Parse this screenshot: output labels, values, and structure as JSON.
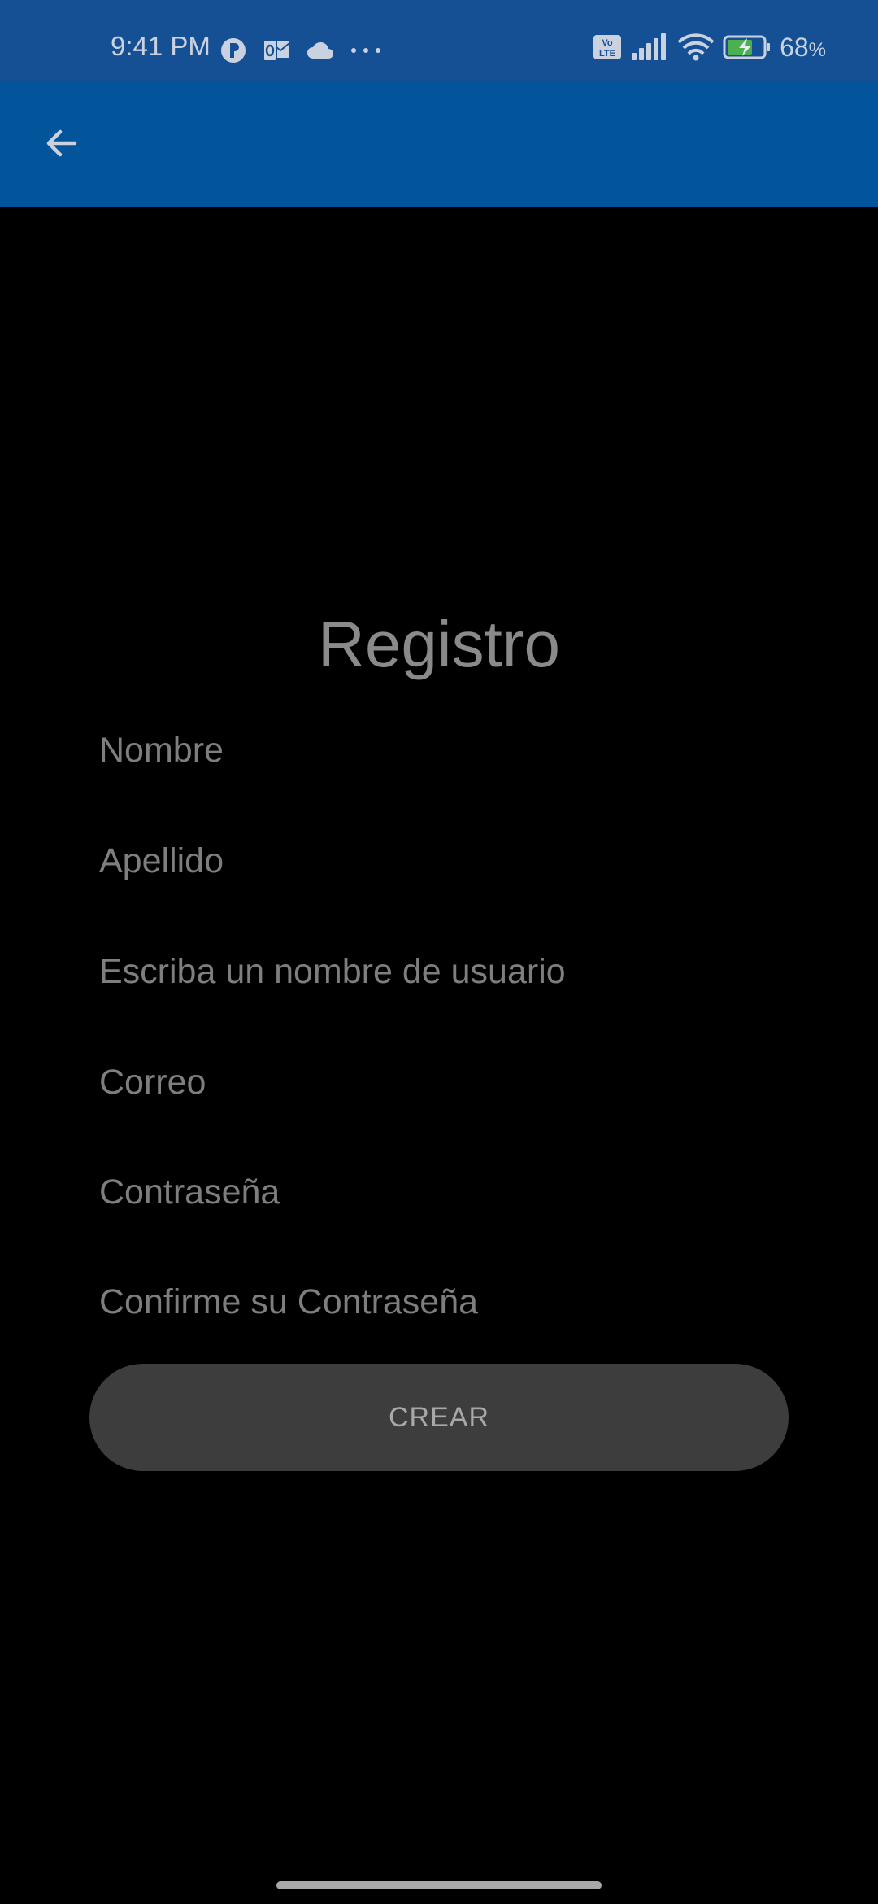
{
  "status_bar": {
    "time": "9:41 PM",
    "more": "···",
    "network_badge": "Vo LTE",
    "battery_level": "68",
    "battery_unit": "%",
    "icons": [
      "pin-icon",
      "outlook-icon",
      "cloud-icon",
      "more-icon",
      "volte-icon",
      "signal-icon",
      "wifi-icon",
      "battery-charging-icon"
    ]
  },
  "app_bar": {
    "back_icon": "arrow-back-icon"
  },
  "form": {
    "title": "Registro",
    "fields": {
      "first_name": "Nombre",
      "last_name": "Apellido",
      "username": "Escriba un nombre de usuario",
      "email": "Correo",
      "password": "Contraseña",
      "confirm_password": "Confirme su Contraseña"
    },
    "submit_label": "CREAR"
  },
  "colors": {
    "status_bar_bg": "#155095",
    "app_bar_bg": "#02559a",
    "background": "#000000",
    "button_bg": "#3d3d3e"
  }
}
